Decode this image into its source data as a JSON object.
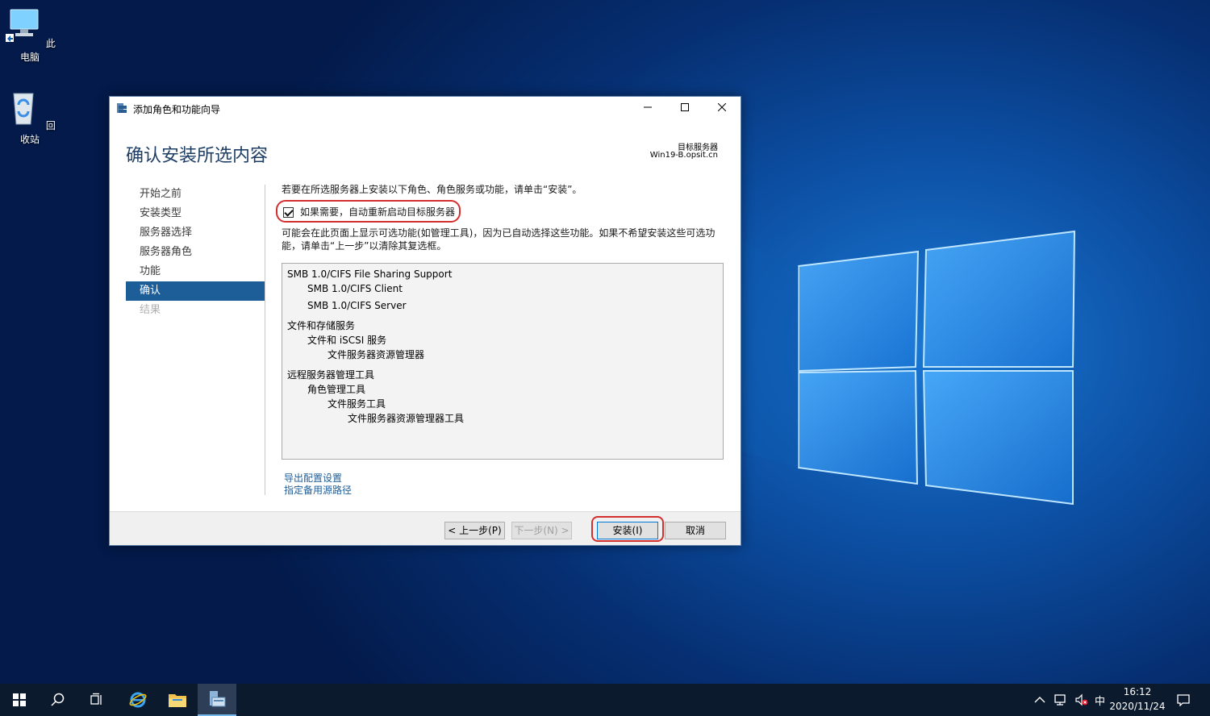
{
  "desktop": {
    "icons": [
      {
        "label": "此电脑",
        "icon": "computer-icon"
      },
      {
        "label": "回收站",
        "icon": "recycle-bin-icon"
      }
    ]
  },
  "wizard": {
    "window_title": "添加角色和功能向导",
    "page_title": "确认安装所选内容",
    "target_server_label": "目标服务器",
    "target_server_name": "Win19-B.opsit.cn",
    "nav": [
      {
        "label": "开始之前",
        "state": "normal"
      },
      {
        "label": "安装类型",
        "state": "normal"
      },
      {
        "label": "服务器选择",
        "state": "normal"
      },
      {
        "label": "服务器角色",
        "state": "normal"
      },
      {
        "label": "功能",
        "state": "normal"
      },
      {
        "label": "确认",
        "state": "active"
      },
      {
        "label": "结果",
        "state": "disabled"
      }
    ],
    "intro_text": "若要在所选服务器上安装以下角色、角色服务或功能，请单击“安装”。",
    "restart_checkbox": {
      "label": "如果需要，自动重新启动目标服务器",
      "checked": true
    },
    "note_text": "可能会在此页面上显示可选功能(如管理工具)，因为已自动选择这些功能。如果不希望安装这些可选功能，请单击“上一步”以清除其复选框。",
    "features": [
      {
        "text": "SMB 1.0/CIFS File Sharing Support",
        "level": 0
      },
      {
        "text": "SMB 1.0/CIFS Client",
        "level": 1
      },
      {
        "text": "SMB 1.0/CIFS Server",
        "level": 1
      },
      {
        "text": "文件和存储服务",
        "level": 0
      },
      {
        "text": "文件和 iSCSI 服务",
        "level": 1
      },
      {
        "text": "文件服务器资源管理器",
        "level": 2
      },
      {
        "text": "远程服务器管理工具",
        "level": 0
      },
      {
        "text": "角色管理工具",
        "level": 1
      },
      {
        "text": "文件服务工具",
        "level": 2
      },
      {
        "text": "文件服务器资源管理器工具",
        "level": 3
      }
    ],
    "links": {
      "export": "导出配置设置",
      "alt_source": "指定备用源路径"
    },
    "buttons": {
      "prev": "< 上一步(P)",
      "next": "下一步(N) >",
      "install": "安装(I)",
      "cancel": "取消"
    },
    "accent_color": "#1e5e98",
    "highlight_color": "#d32f2f"
  },
  "taskbar": {
    "tray_language": "中",
    "clock_time": "16:12",
    "clock_date": "2020/11/24"
  }
}
